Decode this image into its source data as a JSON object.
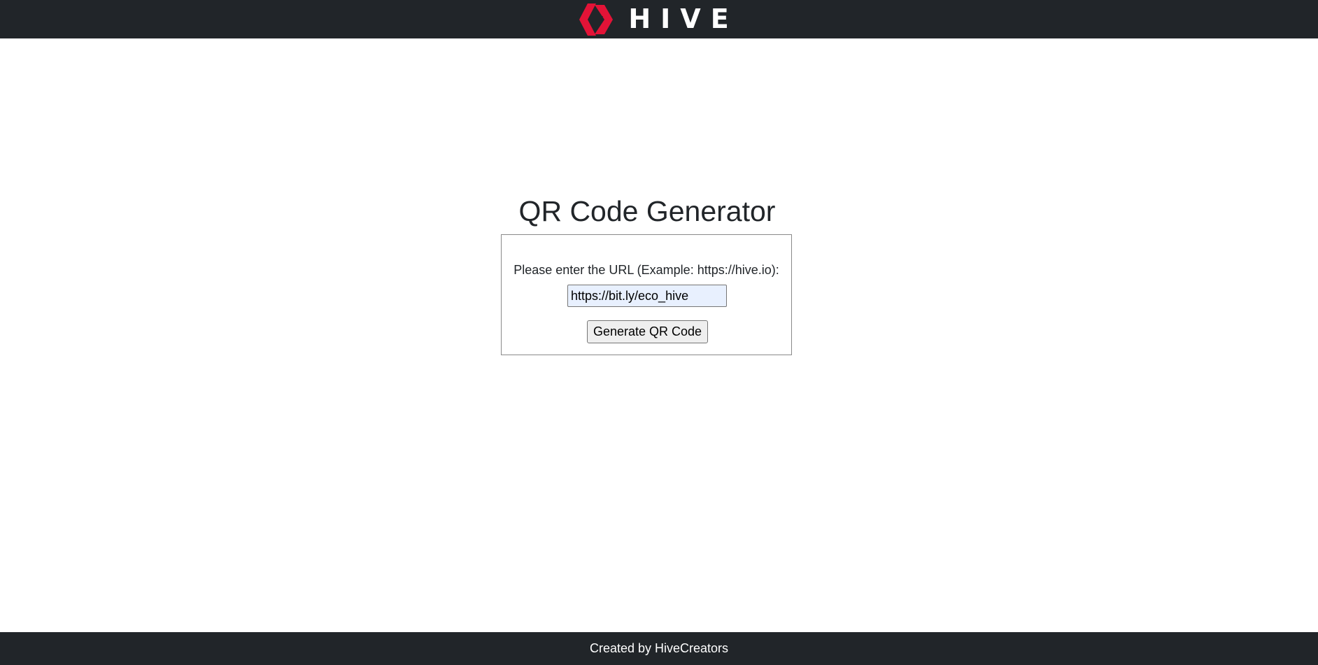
{
  "header": {
    "logo_text": "HIVE",
    "logo_icon": "hive-logo-icon",
    "brand_color": "#e31337",
    "bar_color": "#212529"
  },
  "main": {
    "title": "QR Code Generator",
    "form": {
      "label": "Please enter the URL (Example: https://hive.io):",
      "url_value": "https://bit.ly/eco_hive",
      "button_label": "Generate QR Code"
    }
  },
  "footer": {
    "text": "Created by HiveCreators"
  }
}
